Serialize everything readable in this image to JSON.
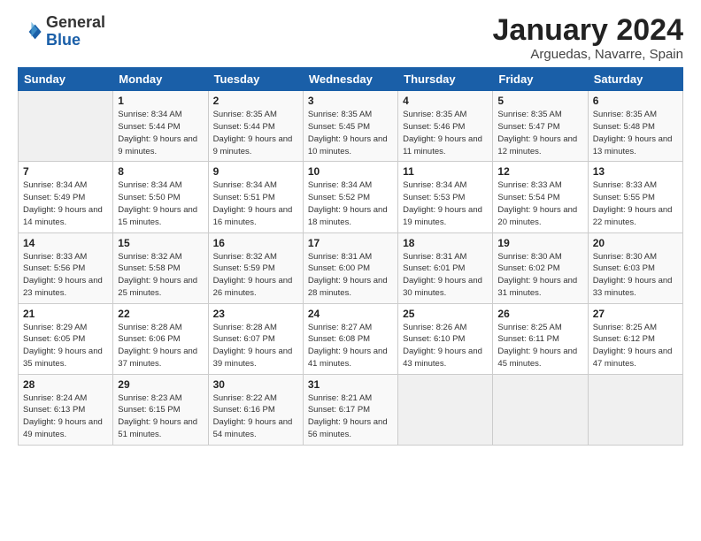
{
  "logo": {
    "text_general": "General",
    "text_blue": "Blue"
  },
  "title": "January 2024",
  "subtitle": "Arguedas, Navarre, Spain",
  "days_of_week": [
    "Sunday",
    "Monday",
    "Tuesday",
    "Wednesday",
    "Thursday",
    "Friday",
    "Saturday"
  ],
  "weeks": [
    [
      {
        "day": "",
        "sunrise": "",
        "sunset": "",
        "daylight": ""
      },
      {
        "day": "1",
        "sunrise": "Sunrise: 8:34 AM",
        "sunset": "Sunset: 5:44 PM",
        "daylight": "Daylight: 9 hours and 9 minutes."
      },
      {
        "day": "2",
        "sunrise": "Sunrise: 8:35 AM",
        "sunset": "Sunset: 5:44 PM",
        "daylight": "Daylight: 9 hours and 9 minutes."
      },
      {
        "day": "3",
        "sunrise": "Sunrise: 8:35 AM",
        "sunset": "Sunset: 5:45 PM",
        "daylight": "Daylight: 9 hours and 10 minutes."
      },
      {
        "day": "4",
        "sunrise": "Sunrise: 8:35 AM",
        "sunset": "Sunset: 5:46 PM",
        "daylight": "Daylight: 9 hours and 11 minutes."
      },
      {
        "day": "5",
        "sunrise": "Sunrise: 8:35 AM",
        "sunset": "Sunset: 5:47 PM",
        "daylight": "Daylight: 9 hours and 12 minutes."
      },
      {
        "day": "6",
        "sunrise": "Sunrise: 8:35 AM",
        "sunset": "Sunset: 5:48 PM",
        "daylight": "Daylight: 9 hours and 13 minutes."
      }
    ],
    [
      {
        "day": "7",
        "sunrise": "Sunrise: 8:34 AM",
        "sunset": "Sunset: 5:49 PM",
        "daylight": "Daylight: 9 hours and 14 minutes."
      },
      {
        "day": "8",
        "sunrise": "Sunrise: 8:34 AM",
        "sunset": "Sunset: 5:50 PM",
        "daylight": "Daylight: 9 hours and 15 minutes."
      },
      {
        "day": "9",
        "sunrise": "Sunrise: 8:34 AM",
        "sunset": "Sunset: 5:51 PM",
        "daylight": "Daylight: 9 hours and 16 minutes."
      },
      {
        "day": "10",
        "sunrise": "Sunrise: 8:34 AM",
        "sunset": "Sunset: 5:52 PM",
        "daylight": "Daylight: 9 hours and 18 minutes."
      },
      {
        "day": "11",
        "sunrise": "Sunrise: 8:34 AM",
        "sunset": "Sunset: 5:53 PM",
        "daylight": "Daylight: 9 hours and 19 minutes."
      },
      {
        "day": "12",
        "sunrise": "Sunrise: 8:33 AM",
        "sunset": "Sunset: 5:54 PM",
        "daylight": "Daylight: 9 hours and 20 minutes."
      },
      {
        "day": "13",
        "sunrise": "Sunrise: 8:33 AM",
        "sunset": "Sunset: 5:55 PM",
        "daylight": "Daylight: 9 hours and 22 minutes."
      }
    ],
    [
      {
        "day": "14",
        "sunrise": "Sunrise: 8:33 AM",
        "sunset": "Sunset: 5:56 PM",
        "daylight": "Daylight: 9 hours and 23 minutes."
      },
      {
        "day": "15",
        "sunrise": "Sunrise: 8:32 AM",
        "sunset": "Sunset: 5:58 PM",
        "daylight": "Daylight: 9 hours and 25 minutes."
      },
      {
        "day": "16",
        "sunrise": "Sunrise: 8:32 AM",
        "sunset": "Sunset: 5:59 PM",
        "daylight": "Daylight: 9 hours and 26 minutes."
      },
      {
        "day": "17",
        "sunrise": "Sunrise: 8:31 AM",
        "sunset": "Sunset: 6:00 PM",
        "daylight": "Daylight: 9 hours and 28 minutes."
      },
      {
        "day": "18",
        "sunrise": "Sunrise: 8:31 AM",
        "sunset": "Sunset: 6:01 PM",
        "daylight": "Daylight: 9 hours and 30 minutes."
      },
      {
        "day": "19",
        "sunrise": "Sunrise: 8:30 AM",
        "sunset": "Sunset: 6:02 PM",
        "daylight": "Daylight: 9 hours and 31 minutes."
      },
      {
        "day": "20",
        "sunrise": "Sunrise: 8:30 AM",
        "sunset": "Sunset: 6:03 PM",
        "daylight": "Daylight: 9 hours and 33 minutes."
      }
    ],
    [
      {
        "day": "21",
        "sunrise": "Sunrise: 8:29 AM",
        "sunset": "Sunset: 6:05 PM",
        "daylight": "Daylight: 9 hours and 35 minutes."
      },
      {
        "day": "22",
        "sunrise": "Sunrise: 8:28 AM",
        "sunset": "Sunset: 6:06 PM",
        "daylight": "Daylight: 9 hours and 37 minutes."
      },
      {
        "day": "23",
        "sunrise": "Sunrise: 8:28 AM",
        "sunset": "Sunset: 6:07 PM",
        "daylight": "Daylight: 9 hours and 39 minutes."
      },
      {
        "day": "24",
        "sunrise": "Sunrise: 8:27 AM",
        "sunset": "Sunset: 6:08 PM",
        "daylight": "Daylight: 9 hours and 41 minutes."
      },
      {
        "day": "25",
        "sunrise": "Sunrise: 8:26 AM",
        "sunset": "Sunset: 6:10 PM",
        "daylight": "Daylight: 9 hours and 43 minutes."
      },
      {
        "day": "26",
        "sunrise": "Sunrise: 8:25 AM",
        "sunset": "Sunset: 6:11 PM",
        "daylight": "Daylight: 9 hours and 45 minutes."
      },
      {
        "day": "27",
        "sunrise": "Sunrise: 8:25 AM",
        "sunset": "Sunset: 6:12 PM",
        "daylight": "Daylight: 9 hours and 47 minutes."
      }
    ],
    [
      {
        "day": "28",
        "sunrise": "Sunrise: 8:24 AM",
        "sunset": "Sunset: 6:13 PM",
        "daylight": "Daylight: 9 hours and 49 minutes."
      },
      {
        "day": "29",
        "sunrise": "Sunrise: 8:23 AM",
        "sunset": "Sunset: 6:15 PM",
        "daylight": "Daylight: 9 hours and 51 minutes."
      },
      {
        "day": "30",
        "sunrise": "Sunrise: 8:22 AM",
        "sunset": "Sunset: 6:16 PM",
        "daylight": "Daylight: 9 hours and 54 minutes."
      },
      {
        "day": "31",
        "sunrise": "Sunrise: 8:21 AM",
        "sunset": "Sunset: 6:17 PM",
        "daylight": "Daylight: 9 hours and 56 minutes."
      },
      {
        "day": "",
        "sunrise": "",
        "sunset": "",
        "daylight": ""
      },
      {
        "day": "",
        "sunrise": "",
        "sunset": "",
        "daylight": ""
      },
      {
        "day": "",
        "sunrise": "",
        "sunset": "",
        "daylight": ""
      }
    ]
  ]
}
